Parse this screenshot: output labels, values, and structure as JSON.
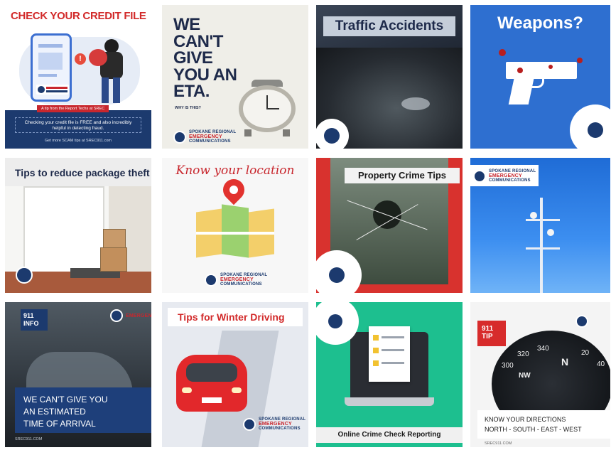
{
  "tiles": {
    "t1": {
      "headline": "CHECK YOUR CREDIT FILE",
      "banner": "A tip from the Report Techs at SREC",
      "body": "Checking your credit file is FREE and also incredibly helpful in detecting fraud.",
      "footer": "Get more SCAM tips at SREC911.com"
    },
    "t2": {
      "headline": "WE CAN'T GIVE YOU AN ETA.",
      "sub": "WHY IS THIS?"
    },
    "t3": {
      "headline": "Traffic Accidents"
    },
    "t4": {
      "headline": "Weapons?"
    },
    "t5": {
      "headline": "Tips to reduce package theft"
    },
    "t6": {
      "headline": "Know your location"
    },
    "t7": {
      "headline": "Property Crime Tips"
    },
    "t9": {
      "badge": "911 INFO",
      "line1": "WE CAN'T GIVE YOU",
      "line2": "AN ESTIMATED",
      "line3": "TIME OF ARRIVAL",
      "footer": "SREC911.COM"
    },
    "t10": {
      "headline": "Tips for Winter Driving"
    },
    "t11": {
      "headline": "Online Crime Check Reporting"
    },
    "t12": {
      "badge": "911 TIP",
      "line1": "KNOW YOUR DIRECTIONS",
      "line2": "NORTH - SOUTH - EAST - WEST",
      "footer": "SREC911.COM",
      "compass": [
        "300",
        "320",
        "340",
        "N",
        "20",
        "NW",
        "40"
      ]
    }
  },
  "logo": {
    "line1": "SPOKANE REGIONAL",
    "line2": "EMERGENCY",
    "line3": "COMMUNICATIONS"
  },
  "colors": {
    "brand_navy": "#1c3a6e",
    "brand_red": "#c8272e",
    "accent_green": "#1dbf8f"
  }
}
